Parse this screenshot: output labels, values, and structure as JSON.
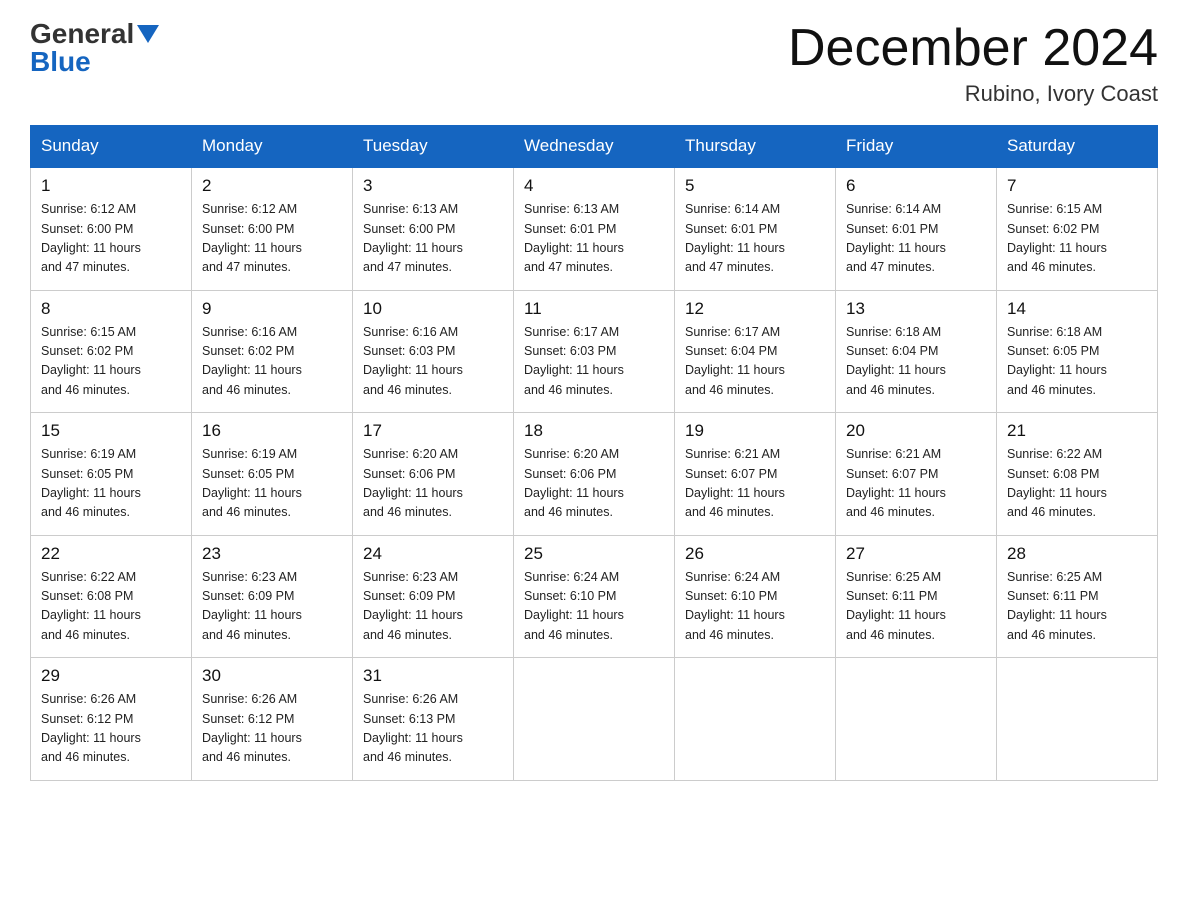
{
  "logo": {
    "general": "General",
    "blue": "Blue",
    "triangle_color": "#1565c0"
  },
  "title": "December 2024",
  "subtitle": "Rubino, Ivory Coast",
  "days_of_week": [
    "Sunday",
    "Monday",
    "Tuesday",
    "Wednesday",
    "Thursday",
    "Friday",
    "Saturday"
  ],
  "weeks": [
    [
      {
        "day": "1",
        "sunrise": "6:12 AM",
        "sunset": "6:00 PM",
        "daylight": "11 hours and 47 minutes."
      },
      {
        "day": "2",
        "sunrise": "6:12 AM",
        "sunset": "6:00 PM",
        "daylight": "11 hours and 47 minutes."
      },
      {
        "day": "3",
        "sunrise": "6:13 AM",
        "sunset": "6:00 PM",
        "daylight": "11 hours and 47 minutes."
      },
      {
        "day": "4",
        "sunrise": "6:13 AM",
        "sunset": "6:01 PM",
        "daylight": "11 hours and 47 minutes."
      },
      {
        "day": "5",
        "sunrise": "6:14 AM",
        "sunset": "6:01 PM",
        "daylight": "11 hours and 47 minutes."
      },
      {
        "day": "6",
        "sunrise": "6:14 AM",
        "sunset": "6:01 PM",
        "daylight": "11 hours and 47 minutes."
      },
      {
        "day": "7",
        "sunrise": "6:15 AM",
        "sunset": "6:02 PM",
        "daylight": "11 hours and 46 minutes."
      }
    ],
    [
      {
        "day": "8",
        "sunrise": "6:15 AM",
        "sunset": "6:02 PM",
        "daylight": "11 hours and 46 minutes."
      },
      {
        "day": "9",
        "sunrise": "6:16 AM",
        "sunset": "6:02 PM",
        "daylight": "11 hours and 46 minutes."
      },
      {
        "day": "10",
        "sunrise": "6:16 AM",
        "sunset": "6:03 PM",
        "daylight": "11 hours and 46 minutes."
      },
      {
        "day": "11",
        "sunrise": "6:17 AM",
        "sunset": "6:03 PM",
        "daylight": "11 hours and 46 minutes."
      },
      {
        "day": "12",
        "sunrise": "6:17 AM",
        "sunset": "6:04 PM",
        "daylight": "11 hours and 46 minutes."
      },
      {
        "day": "13",
        "sunrise": "6:18 AM",
        "sunset": "6:04 PM",
        "daylight": "11 hours and 46 minutes."
      },
      {
        "day": "14",
        "sunrise": "6:18 AM",
        "sunset": "6:05 PM",
        "daylight": "11 hours and 46 minutes."
      }
    ],
    [
      {
        "day": "15",
        "sunrise": "6:19 AM",
        "sunset": "6:05 PM",
        "daylight": "11 hours and 46 minutes."
      },
      {
        "day": "16",
        "sunrise": "6:19 AM",
        "sunset": "6:05 PM",
        "daylight": "11 hours and 46 minutes."
      },
      {
        "day": "17",
        "sunrise": "6:20 AM",
        "sunset": "6:06 PM",
        "daylight": "11 hours and 46 minutes."
      },
      {
        "day": "18",
        "sunrise": "6:20 AM",
        "sunset": "6:06 PM",
        "daylight": "11 hours and 46 minutes."
      },
      {
        "day": "19",
        "sunrise": "6:21 AM",
        "sunset": "6:07 PM",
        "daylight": "11 hours and 46 minutes."
      },
      {
        "day": "20",
        "sunrise": "6:21 AM",
        "sunset": "6:07 PM",
        "daylight": "11 hours and 46 minutes."
      },
      {
        "day": "21",
        "sunrise": "6:22 AM",
        "sunset": "6:08 PM",
        "daylight": "11 hours and 46 minutes."
      }
    ],
    [
      {
        "day": "22",
        "sunrise": "6:22 AM",
        "sunset": "6:08 PM",
        "daylight": "11 hours and 46 minutes."
      },
      {
        "day": "23",
        "sunrise": "6:23 AM",
        "sunset": "6:09 PM",
        "daylight": "11 hours and 46 minutes."
      },
      {
        "day": "24",
        "sunrise": "6:23 AM",
        "sunset": "6:09 PM",
        "daylight": "11 hours and 46 minutes."
      },
      {
        "day": "25",
        "sunrise": "6:24 AM",
        "sunset": "6:10 PM",
        "daylight": "11 hours and 46 minutes."
      },
      {
        "day": "26",
        "sunrise": "6:24 AM",
        "sunset": "6:10 PM",
        "daylight": "11 hours and 46 minutes."
      },
      {
        "day": "27",
        "sunrise": "6:25 AM",
        "sunset": "6:11 PM",
        "daylight": "11 hours and 46 minutes."
      },
      {
        "day": "28",
        "sunrise": "6:25 AM",
        "sunset": "6:11 PM",
        "daylight": "11 hours and 46 minutes."
      }
    ],
    [
      {
        "day": "29",
        "sunrise": "6:26 AM",
        "sunset": "6:12 PM",
        "daylight": "11 hours and 46 minutes."
      },
      {
        "day": "30",
        "sunrise": "6:26 AM",
        "sunset": "6:12 PM",
        "daylight": "11 hours and 46 minutes."
      },
      {
        "day": "31",
        "sunrise": "6:26 AM",
        "sunset": "6:13 PM",
        "daylight": "11 hours and 46 minutes."
      },
      null,
      null,
      null,
      null
    ]
  ],
  "labels": {
    "sunrise": "Sunrise:",
    "sunset": "Sunset:",
    "daylight": "Daylight:"
  }
}
